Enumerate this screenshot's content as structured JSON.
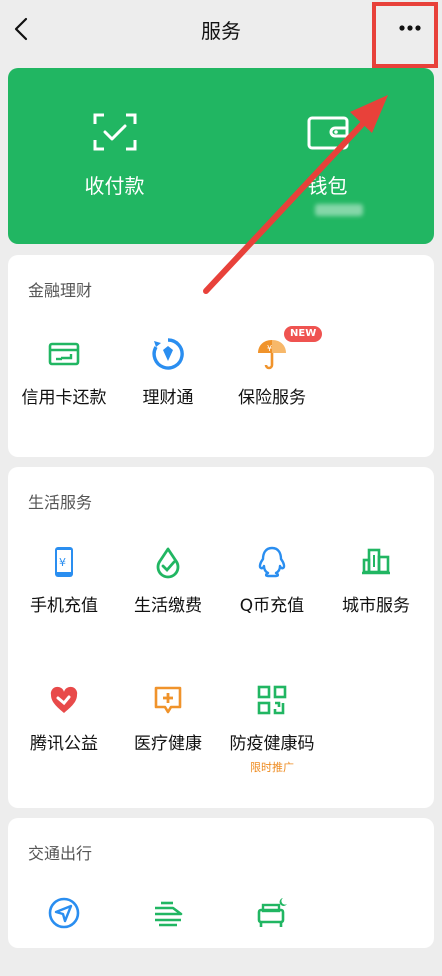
{
  "header": {
    "title": "服务"
  },
  "wallet_panel": {
    "pay_label": "收付款",
    "wallet_label": "钱包"
  },
  "finance": {
    "title": "金融理财",
    "items": [
      {
        "label": "信用卡还款",
        "icon": "credit-card-icon"
      },
      {
        "label": "理财通",
        "icon": "wealth-icon"
      },
      {
        "label": "保险服务",
        "icon": "insurance-icon",
        "badge": "NEW"
      }
    ]
  },
  "life": {
    "title": "生活服务",
    "items": [
      {
        "label": "手机充值",
        "icon": "phone-icon"
      },
      {
        "label": "生活缴费",
        "icon": "utility-icon"
      },
      {
        "label": "Q币充值",
        "icon": "qq-icon"
      },
      {
        "label": "城市服务",
        "icon": "city-icon"
      },
      {
        "label": "腾讯公益",
        "icon": "charity-icon"
      },
      {
        "label": "医疗健康",
        "icon": "medical-icon"
      },
      {
        "label": "防疫健康码",
        "icon": "qrcode-icon",
        "note": "限时推广"
      }
    ]
  },
  "transport": {
    "title": "交通出行",
    "items": [
      {
        "icon": "navigation-icon"
      },
      {
        "icon": "train-icon"
      },
      {
        "icon": "hotel-icon"
      }
    ]
  },
  "colors": {
    "brand_green": "#21b662",
    "highlight_red": "#e8413a",
    "blue": "#2a8ef0",
    "orange": "#f0932b"
  }
}
